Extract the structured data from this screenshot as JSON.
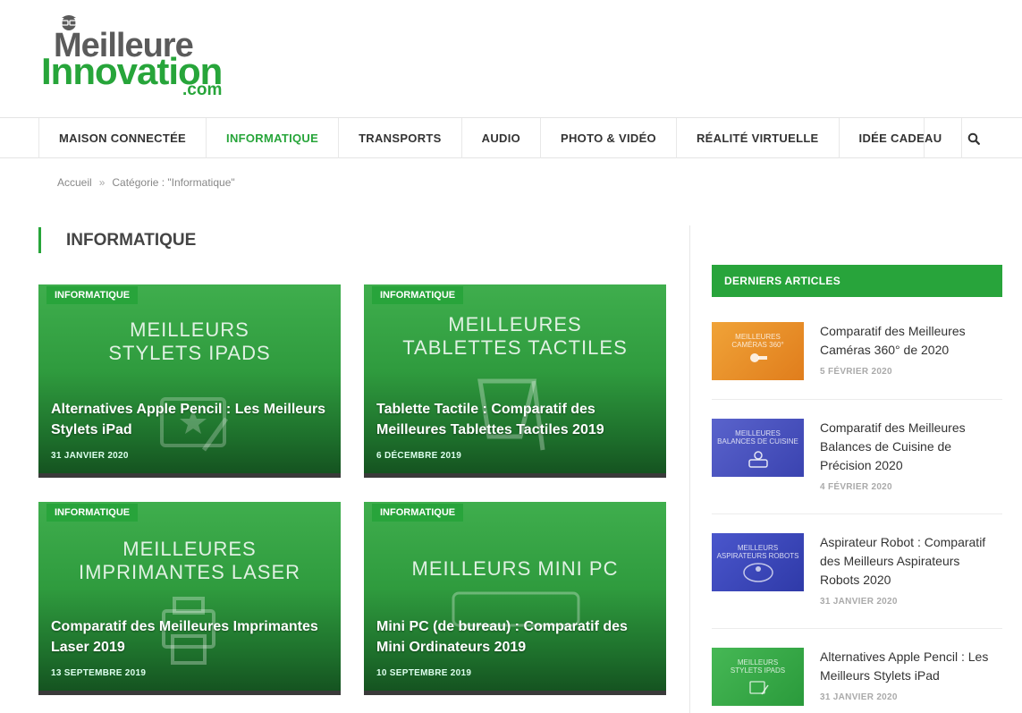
{
  "logo": {
    "line1": "Meilleure",
    "line2": "Innovation",
    "line3": ".com"
  },
  "nav": {
    "items": [
      {
        "label": "MAISON CONNECTÉE"
      },
      {
        "label": "INFORMATIQUE"
      },
      {
        "label": "TRANSPORTS"
      },
      {
        "label": "AUDIO"
      },
      {
        "label": "PHOTO & VIDÉO"
      },
      {
        "label": "RÉALITÉ VIRTUELLE"
      },
      {
        "label": "IDÉE CADEAU"
      }
    ],
    "search_icon": "search-icon"
  },
  "breadcrumb": {
    "home": "Accueil",
    "separator": "»",
    "current": "Catégorie : \"Informatique\""
  },
  "section": {
    "title": "INFORMATIQUE"
  },
  "cards": [
    {
      "badge": "INFORMATIQUE",
      "banner": "MEILLEURS\nSTYLETS IPADS",
      "title": "Alternatives Apple Pencil : Les Meilleurs Stylets iPad",
      "date": "31 JANVIER 2020"
    },
    {
      "badge": "INFORMATIQUE",
      "banner": "MEILLEURES\nTABLETTES TACTILES",
      "title": "Tablette Tactile : Comparatif des Meilleures Tablettes Tactiles 2019",
      "date": "6 DÉCEMBRE 2019"
    },
    {
      "badge": "INFORMATIQUE",
      "banner": "MEILLEURES\nIMPRIMANTES LASER",
      "title": "Comparatif des Meilleures Imprimantes Laser 2019",
      "date": "13 SEPTEMBRE 2019"
    },
    {
      "badge": "INFORMATIQUE",
      "banner": "MEILLEURS MINI PC",
      "title": "Mini PC (de bureau) : Comparatif des Mini Ordinateurs 2019",
      "date": "10 SEPTEMBRE 2019"
    }
  ],
  "sidebar": {
    "heading": "DERNIERS ARTICLES",
    "posts": [
      {
        "thumb_caption": "MEILLEURES\nCAMÉRAS 360°",
        "title": "Comparatif des Meilleures Caméras 360° de 2020",
        "date": "5 FÉVRIER 2020",
        "color": "#e8902a"
      },
      {
        "thumb_caption": "MEILLEURES\nBALANCES DE CUISINE",
        "title": "Comparatif des Meilleures Balances de Cuisine de Précision 2020",
        "date": "4 FÉVRIER 2020",
        "color": "#4a55c0"
      },
      {
        "thumb_caption": "MEILLEURS\nASPIRATEURS ROBOTS",
        "title": "Aspirateur Robot : Comparatif des Meilleurs Aspirateurs Robots 2020",
        "date": "31 JANVIER 2020",
        "color": "#3f4ec4"
      },
      {
        "thumb_caption": "MEILLEURS\nSTYLETS IPADS",
        "title": "Alternatives Apple Pencil : Les Meilleurs Stylets iPad",
        "date": "31 JANVIER 2020",
        "color": "#34a845"
      }
    ]
  },
  "colors": {
    "accent": "#27a53a",
    "logo_grey": "#5b5b5b"
  }
}
